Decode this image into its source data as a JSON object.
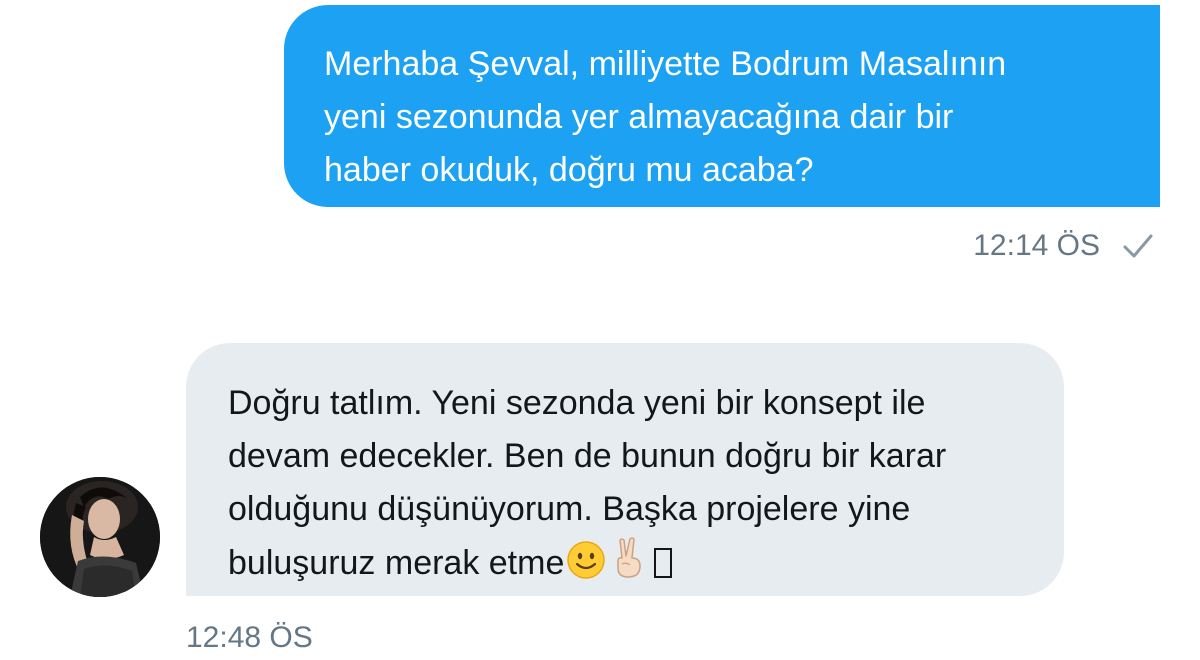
{
  "conversation": {
    "sent_message": {
      "lines": [
        "Merhaba Şevval, milliyette Bodrum Masalının",
        "yeni sezonunda yer almayacağına dair bir",
        "haber okuduk, doğru mu acaba?"
      ],
      "time": "12:14 ÖS",
      "status_icon": "check-icon"
    },
    "received_message": {
      "lines": [
        "Doğru tatlım. Yeni sezonda yeni bir konsept ile",
        "devam edecekler. Ben de bunun doğru bir karar",
        "olduğunu düşünüyorum. Başka projelere yine",
        "buluşuruz merak etme"
      ],
      "emojis": [
        "smiling-face-emoji",
        "victory-hand-emoji",
        "missing-glyph-box"
      ],
      "time": "12:48 ÖS",
      "avatar_icon": "profile-photo-avatar"
    }
  },
  "colors": {
    "sent_bubble": "#1da1f2",
    "received_bubble": "#e6ecf0",
    "timestamp": "#657786",
    "received_text": "#14171a"
  }
}
